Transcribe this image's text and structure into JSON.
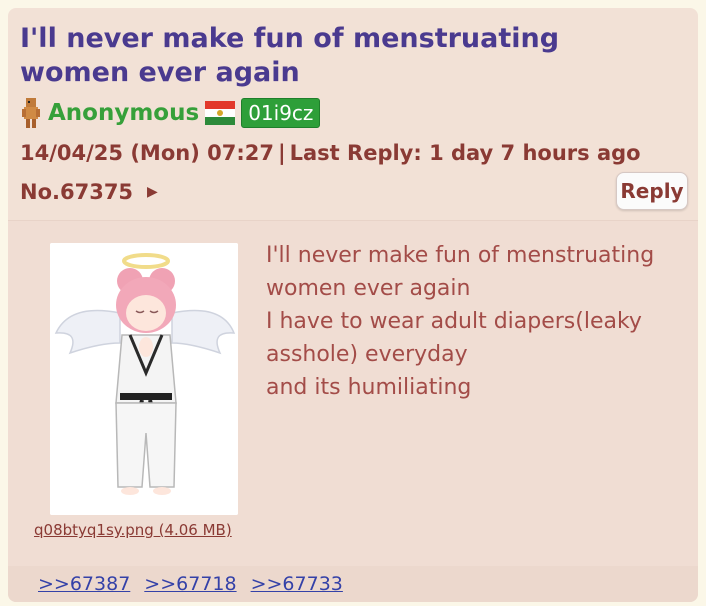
{
  "post": {
    "title": "I'll never make fun of menstruating women ever again",
    "author": "Anonymous",
    "poster_id": "01i9cz",
    "date": "14/04/25 (Mon) 07:27",
    "last_reply": "Last Reply: 1 day 7 hours ago",
    "number": "No.67375",
    "reply_label": "Reply",
    "filename": "q08btyq1sy.png (4.06 MB)",
    "message_lines": [
      "I'll never make fun of menstruating",
      "women ever again",
      "I have to wear adult diapers(leaky",
      "asshole) everyday",
      "and its humiliating"
    ],
    "replies": [
      ">>67387",
      ">>67718",
      ">>67733"
    ]
  },
  "icons": {
    "avatar": "pixel-character-icon",
    "flag": "country-flag-icon",
    "arrow": "triangle-right-icon"
  },
  "colors": {
    "title": "#4a3a8f",
    "name": "#36a03a",
    "id_badge": "#2e9f39",
    "meta": "#8a3a34",
    "message": "#a34c48",
    "link": "#3441a8",
    "card_bg": "#f2e1d6"
  }
}
